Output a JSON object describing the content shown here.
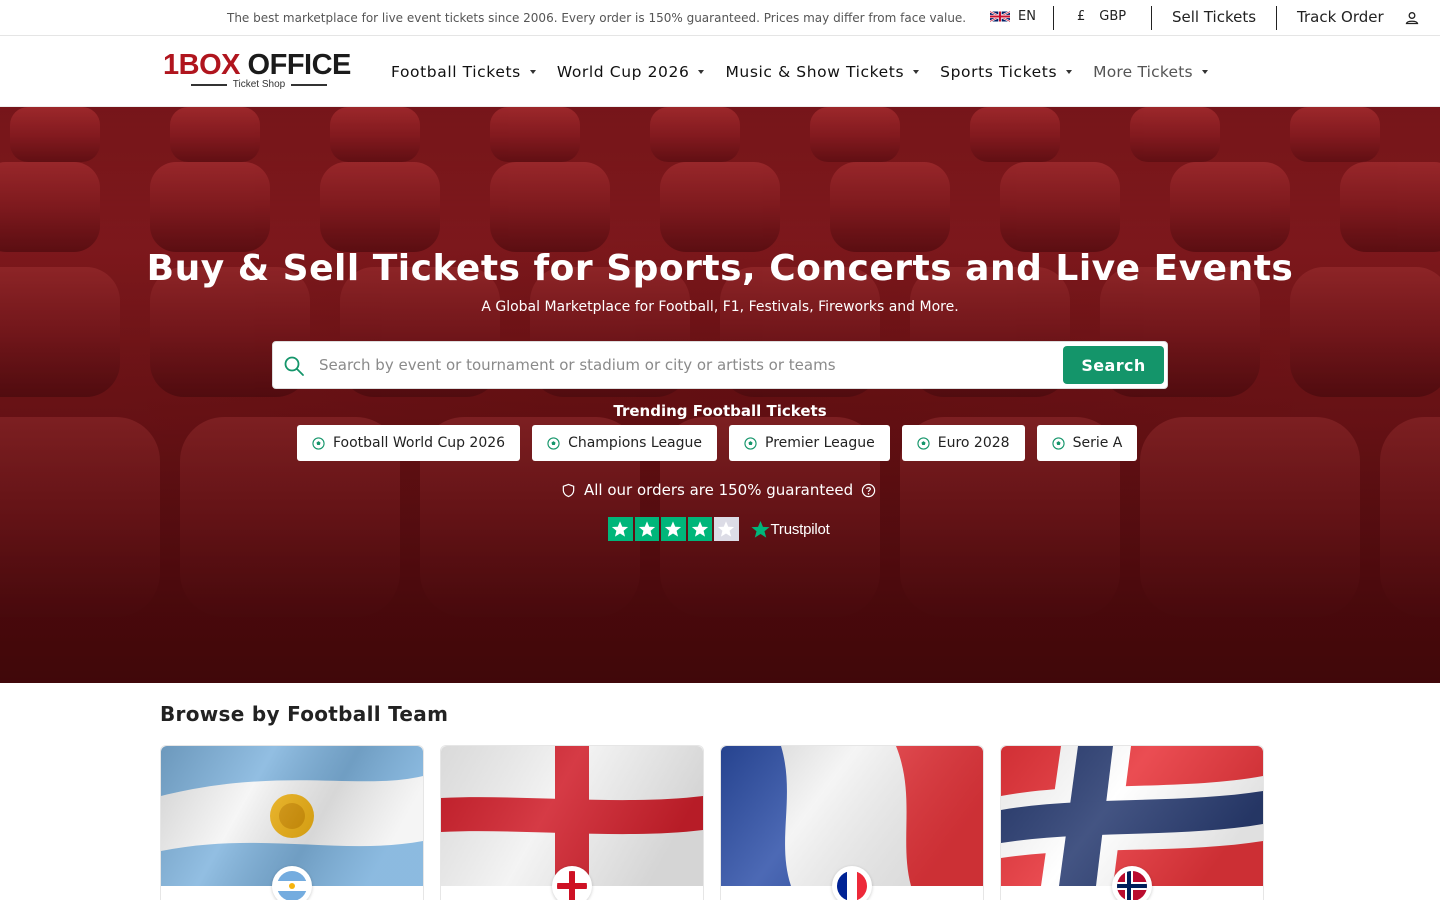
{
  "topbar": {
    "tagline": "The best marketplace for live event tickets since 2006. Every order is 150% guaranteed. Prices may differ from face value.",
    "language": "EN",
    "currency_symbol": "£",
    "currency": "GBP",
    "sell_tickets": "Sell Tickets",
    "track_order": "Track Order"
  },
  "logo": {
    "number": "1",
    "box": "BOX",
    "office": "OFFICE",
    "subtitle": "Ticket Shop"
  },
  "nav": {
    "items": [
      {
        "label": "Football Tickets"
      },
      {
        "label": "World Cup 2026"
      },
      {
        "label": "Music & Show Tickets"
      },
      {
        "label": "Sports Tickets"
      },
      {
        "label": "More Tickets"
      }
    ]
  },
  "hero": {
    "title": "Buy & Sell Tickets for Sports, Concerts and Live Events",
    "subtitle": "A Global Marketplace for Football, F1, Festivals, Fireworks and More.",
    "search_placeholder": "Search by event or tournament or stadium or city or artists or teams",
    "search_button": "Search",
    "trending_title": "Trending Football Tickets",
    "trending": [
      {
        "label": "Football World Cup 2026"
      },
      {
        "label": "Champions League"
      },
      {
        "label": "Premier League"
      },
      {
        "label": "Euro 2028"
      },
      {
        "label": "Serie A"
      }
    ],
    "guarantee": "All our orders are 150% guaranteed",
    "trustpilot": {
      "label": "Trustpilot",
      "stars_filled": 4,
      "stars_total": 5
    }
  },
  "browse": {
    "title": "Browse by Football Team",
    "teams": [
      {
        "flag": "argentina-flag"
      },
      {
        "flag": "england-flag"
      },
      {
        "flag": "france-flag"
      },
      {
        "flag": "norway-flag"
      }
    ]
  },
  "colors": {
    "accent_green": "#14956a",
    "brand_red": "#b0151e",
    "trustpilot_green": "#00b67a"
  }
}
